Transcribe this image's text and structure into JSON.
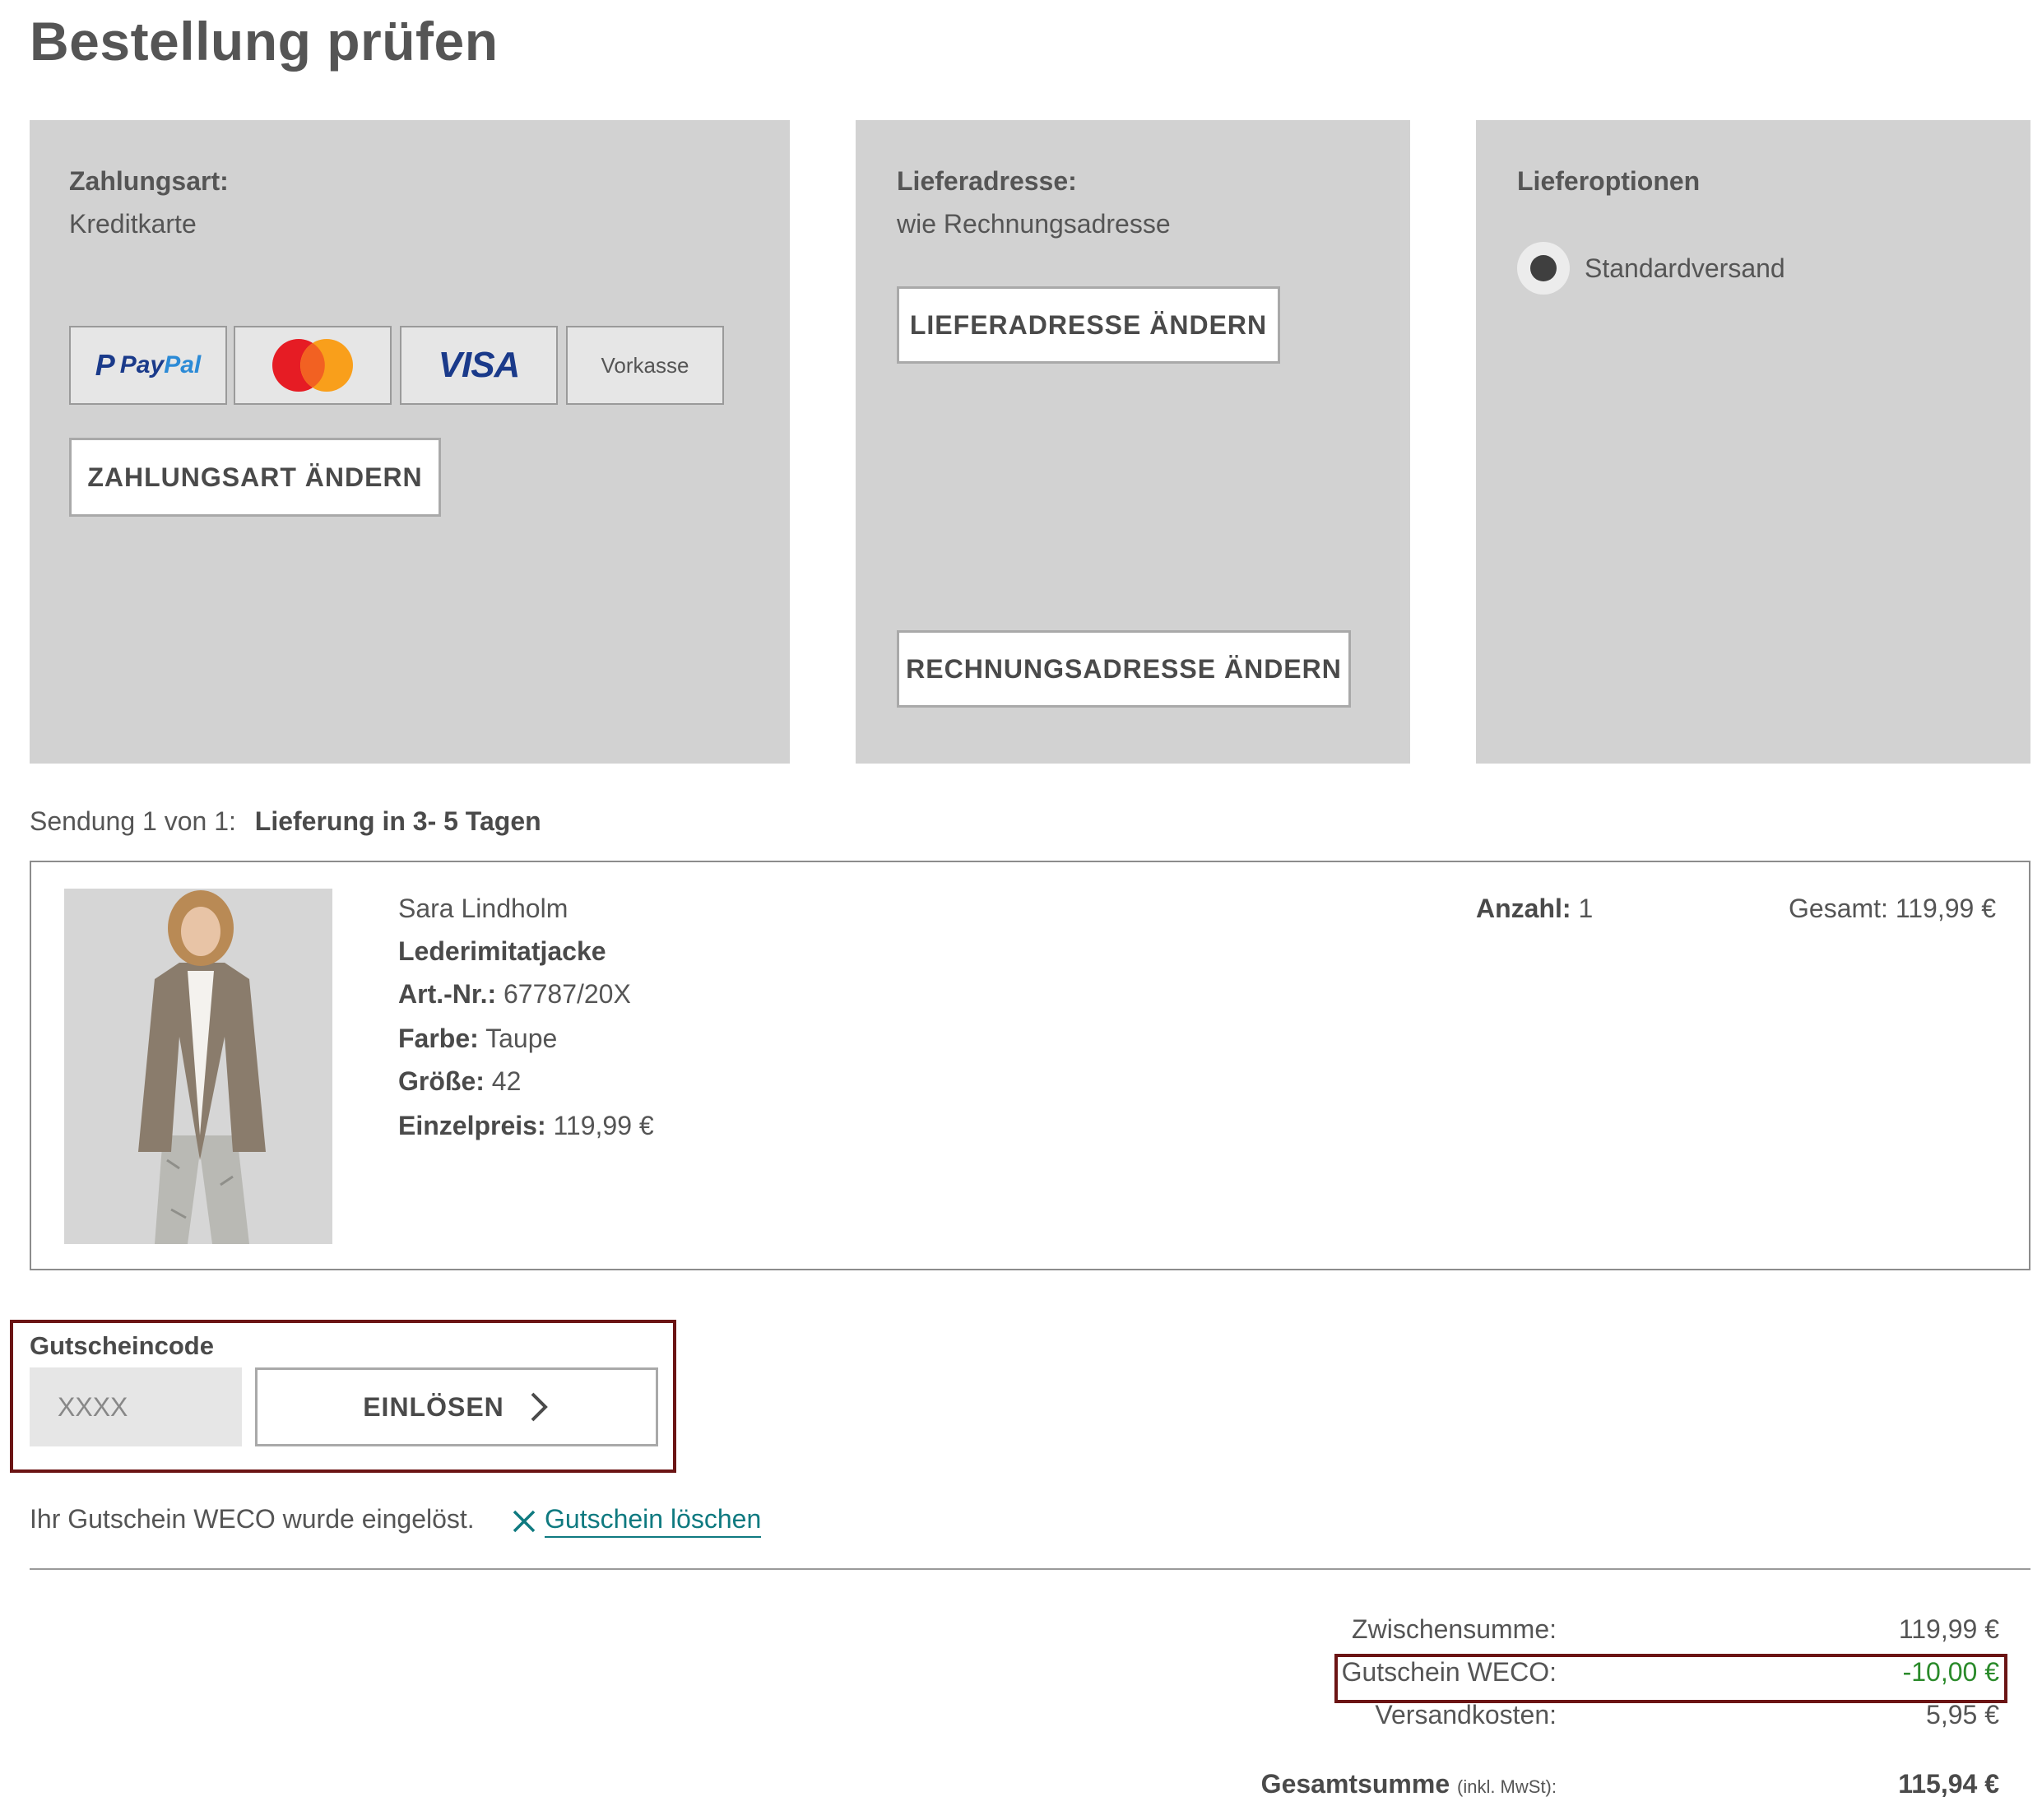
{
  "page": {
    "title": "Bestellung prüfen"
  },
  "payment": {
    "label": "Zahlungsart:",
    "value": "Kreditkarte",
    "methods": {
      "paypal_p": "P",
      "paypal_pay": "Pay",
      "paypal_pal": "Pal",
      "visa": "VISA",
      "vorkasse": "Vorkasse"
    },
    "change_button": "ZAHLUNGSART ÄNDERN"
  },
  "delivery_address": {
    "label": "Lieferadresse:",
    "value": "wie Rechnungsadresse",
    "change_button": "LIEFERADRESSE ÄNDERN",
    "billing_button": "RECHNUNGSADRESSE ÄNDERN"
  },
  "delivery_options": {
    "label": "Lieferoptionen",
    "selected_option": "Standardversand"
  },
  "shipment": {
    "prefix": "Sendung 1 von 1:",
    "delivery_time": "Lieferung in 3- 5 Tagen"
  },
  "product": {
    "brand": "Sara Lindholm",
    "name": "Lederimitatjacke",
    "article_label": "Art.-Nr.:",
    "article_value": "67787/20X",
    "color_label": "Farbe:",
    "color_value": "Taupe",
    "size_label": "Größe:",
    "size_value": "42",
    "unit_price_label": "Einzelpreis:",
    "unit_price_value": "119,99 €",
    "quantity_label": "Anzahl:",
    "quantity_value": "1",
    "total_label": "Gesamt:",
    "total_value": "119,99 €"
  },
  "voucher": {
    "label": "Gutscheincode",
    "placeholder": "XXXX",
    "redeem_button": "EINLÖSEN",
    "redeemed_message": "Ihr Gutschein WECO wurde eingelöst.",
    "delete_link": "Gutschein löschen"
  },
  "summary": {
    "subtotal_label": "Zwischensumme:",
    "subtotal_value": "119,99 €",
    "voucher_label": "Gutschein WECO:",
    "voucher_value": "-10,00 €",
    "shipping_label": "Versandkosten:",
    "shipping_value": "5,95 €",
    "total_label": "Gesamtsumme",
    "total_note": "(inkl. MwSt):",
    "total_value": "115,94 €"
  },
  "colors": {
    "panel_bg": "#d2d2d2",
    "link_teal": "#0f7a80",
    "discount_green": "#2a8a2a",
    "highlight_red": "#6b1414"
  }
}
